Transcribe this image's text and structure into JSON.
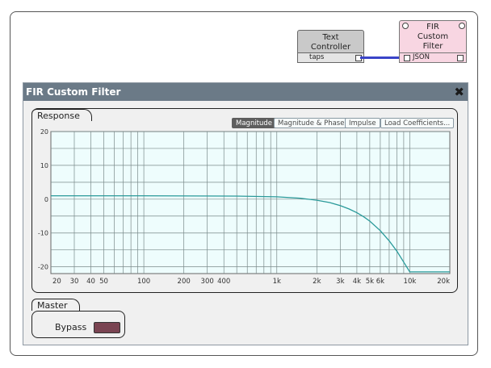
{
  "text_controller": {
    "title": "Text Controller",
    "port": "taps"
  },
  "fir_block": {
    "title": "FIR Custom Filter",
    "port": "JSON"
  },
  "panel": {
    "title": "FIR Custom Filter"
  },
  "response": {
    "group_label": "Response",
    "buttons": [
      "Magnitude",
      "Magnitude & Phase",
      "Impulse",
      "Load Coefficients..."
    ],
    "active_button": "Magnitude"
  },
  "chart_data": {
    "type": "line",
    "title": "",
    "xlabel": "",
    "ylabel": "",
    "xscale": "log",
    "xlim": [
      20,
      20000
    ],
    "ylim": [
      -22,
      20
    ],
    "x_ticks": [
      20,
      30,
      40,
      50,
      100,
      200,
      300,
      400,
      1000,
      2000,
      3000,
      4000,
      5000,
      6000,
      10000,
      20000
    ],
    "x_tick_labels": [
      "20",
      "30",
      "40",
      "50",
      "100",
      "200",
      "300",
      "400",
      "1k",
      "2k",
      "3k",
      "4k",
      "5k",
      "6k",
      "10k",
      "20k"
    ],
    "y_ticks": [
      20,
      10,
      0,
      -10,
      -20
    ],
    "y_tick_labels": [
      "20",
      "10",
      "0",
      "-10",
      "-20"
    ],
    "grid": true,
    "series": [
      {
        "x": [
          20,
          100,
          500,
          1000,
          1500,
          2000,
          2500,
          3000,
          3500,
          4000,
          4500,
          5000,
          6000,
          7000,
          8000,
          9000,
          10000,
          20000
        ],
        "y": [
          1,
          1,
          0.9,
          0.7,
          0.3,
          -0.3,
          -1.0,
          -1.9,
          -2.9,
          -4.0,
          -5.2,
          -6.5,
          -9.3,
          -12.3,
          -15.4,
          -18.6,
          -21.5,
          -21.5
        ]
      }
    ],
    "line_color": "#2a9a9a",
    "background": "#eefdfd",
    "grid_color": "#7a8a8a"
  },
  "master": {
    "group_label": "Master",
    "bypass_label": "Bypass"
  }
}
